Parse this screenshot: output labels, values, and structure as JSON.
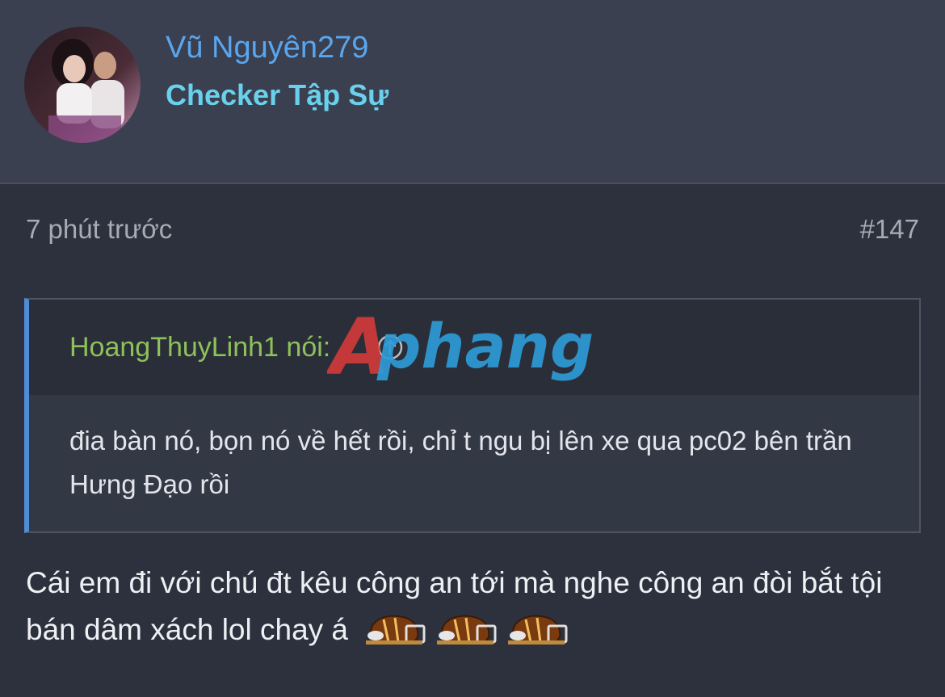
{
  "user": {
    "name": "Vũ Nguyên279",
    "title": "Checker Tập Sự"
  },
  "post": {
    "time": "7 phút trước",
    "number": "#147",
    "quote": {
      "author_line": "HoangThuyLinh1 nói:",
      "text": "đia bàn nó, bọn nó về hết rồi, chỉ t ngu bị lên xe qua pc02 bên trần Hưng Đạo rồi"
    },
    "message": "Cái em đi với chú đt kêu công an tới mà nghe công an đòi bắt tội bán dâm xách lol chay á",
    "emojis": [
      "football-helmet-emoji",
      "football-helmet-emoji",
      "football-helmet-emoji"
    ]
  },
  "watermark": {
    "text": "Aphang"
  },
  "colors": {
    "background": "#2d313d",
    "header_background": "#3a4050",
    "username": "#5aa6ee",
    "user_title": "#6ad1ec",
    "quote_author": "#8fc15b",
    "quote_border": "#4f8ed4",
    "meta_text": "#a7abb4"
  }
}
